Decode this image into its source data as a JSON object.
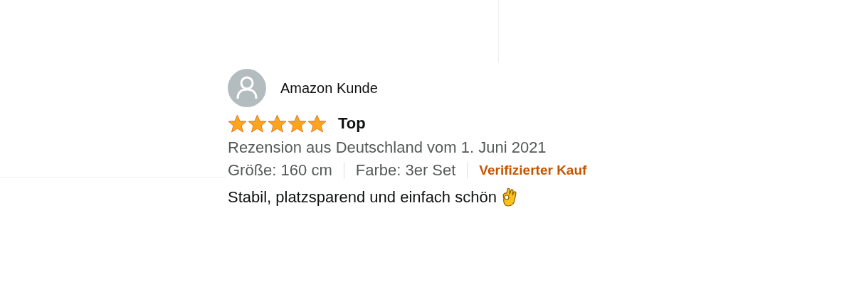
{
  "review": {
    "author": "Amazon Kunde",
    "stars": 5,
    "title": "Top",
    "meta": "Rezension aus Deutschland vom 1. Juni 2021",
    "variants": [
      "Größe: 160 cm",
      "Farbe: 3er Set"
    ],
    "badge": "Verifizierter Kauf",
    "body": "Stabil, platzsparend und einfach schön"
  }
}
